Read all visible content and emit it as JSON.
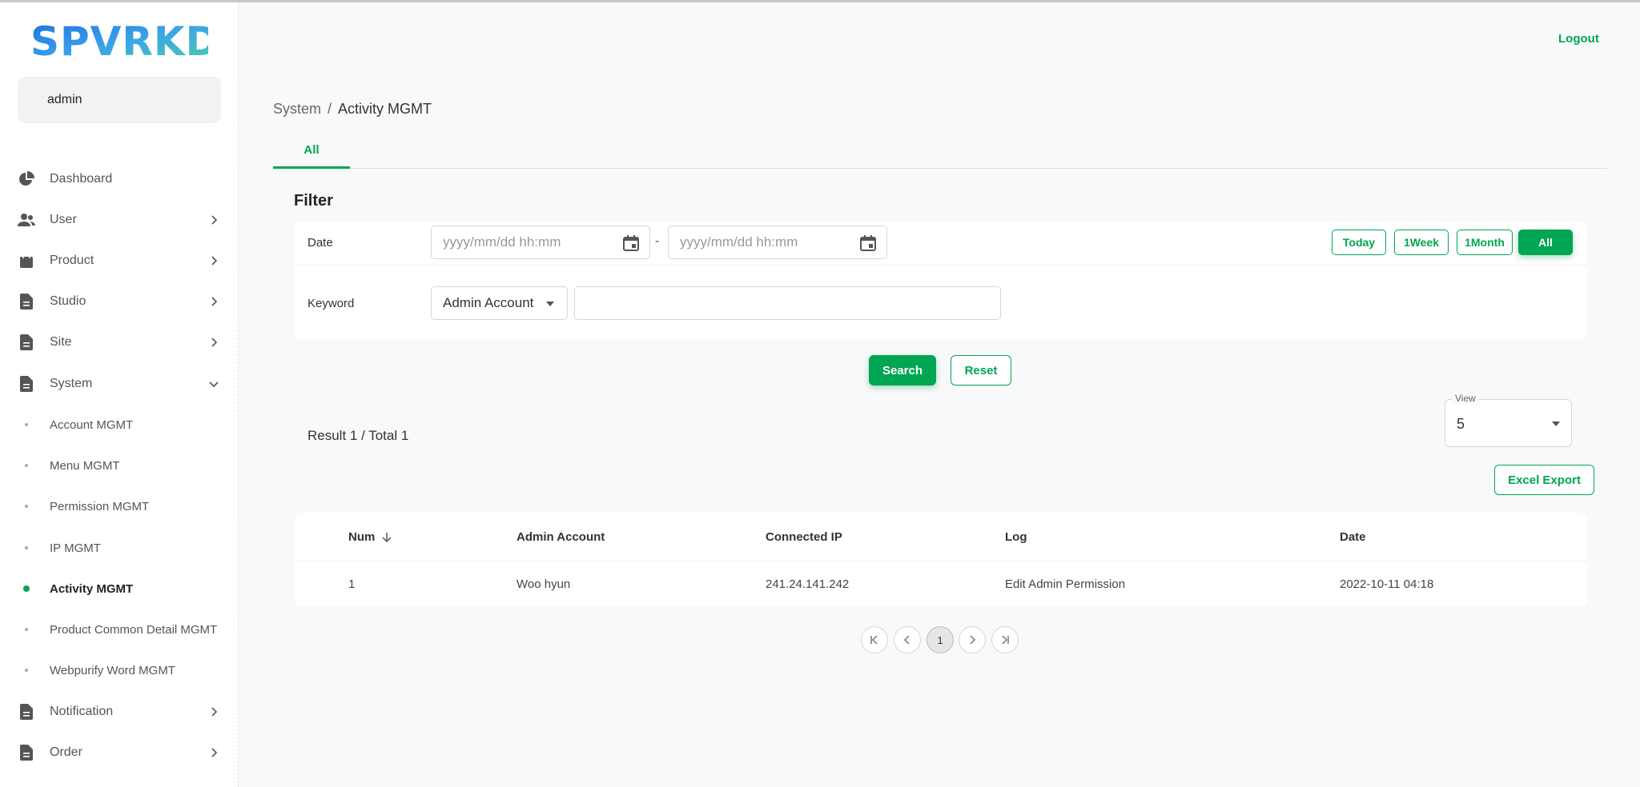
{
  "app": {
    "brand": "SPVRKD",
    "user": "admin",
    "logout": "Logout"
  },
  "sidebar": {
    "items": [
      {
        "label": "Dashboard",
        "icon": "pie-chart-icon"
      },
      {
        "label": "User",
        "icon": "users-icon"
      },
      {
        "label": "Product",
        "icon": "bag-icon"
      },
      {
        "label": "Studio",
        "icon": "document-icon"
      },
      {
        "label": "Site",
        "icon": "document-icon"
      },
      {
        "label": "System",
        "icon": "document-icon",
        "expanded": true
      }
    ],
    "system_sub": [
      "Account MGMT",
      "Menu MGMT",
      "Permission MGMT",
      "IP MGMT",
      "Activity MGMT",
      "Product Common Detail MGMT",
      "Webpurify Word MGMT"
    ],
    "active_sub": "Activity MGMT",
    "items_after": [
      {
        "label": "Notification",
        "icon": "document-icon"
      },
      {
        "label": "Order",
        "icon": "document-icon"
      }
    ]
  },
  "breadcrumb": {
    "parent": "System",
    "separator": "/",
    "current": "Activity MGMT"
  },
  "tabs": [
    {
      "label": "All",
      "active": true
    }
  ],
  "filter": {
    "title": "Filter",
    "date_label": "Date",
    "date_placeholder_start": "yyyy/mm/dd hh:mm",
    "date_placeholder_end": "yyyy/mm/dd hh:mm",
    "date_separator": "-",
    "ranges": [
      "Today",
      "1Week",
      "1Month",
      "All"
    ],
    "active_range": "All",
    "keyword_label": "Keyword",
    "keyword_select": "Admin Account",
    "keyword_value": ""
  },
  "actions": {
    "search": "Search",
    "reset": "Reset",
    "excel": "Excel Export"
  },
  "result": {
    "text": "Result 1 / Total 1"
  },
  "view": {
    "label": "View",
    "value": "5"
  },
  "table": {
    "headers": [
      "Num",
      "Admin Account",
      "Connected IP",
      "Log",
      "Date"
    ],
    "rows": [
      [
        "1",
        "Woo hyun",
        "241.24.141.242",
        "Edit Admin Permission",
        "2022-10-11 04:18"
      ]
    ]
  },
  "pagination": {
    "current": "1"
  },
  "colors": {
    "accent": "#00a651"
  }
}
